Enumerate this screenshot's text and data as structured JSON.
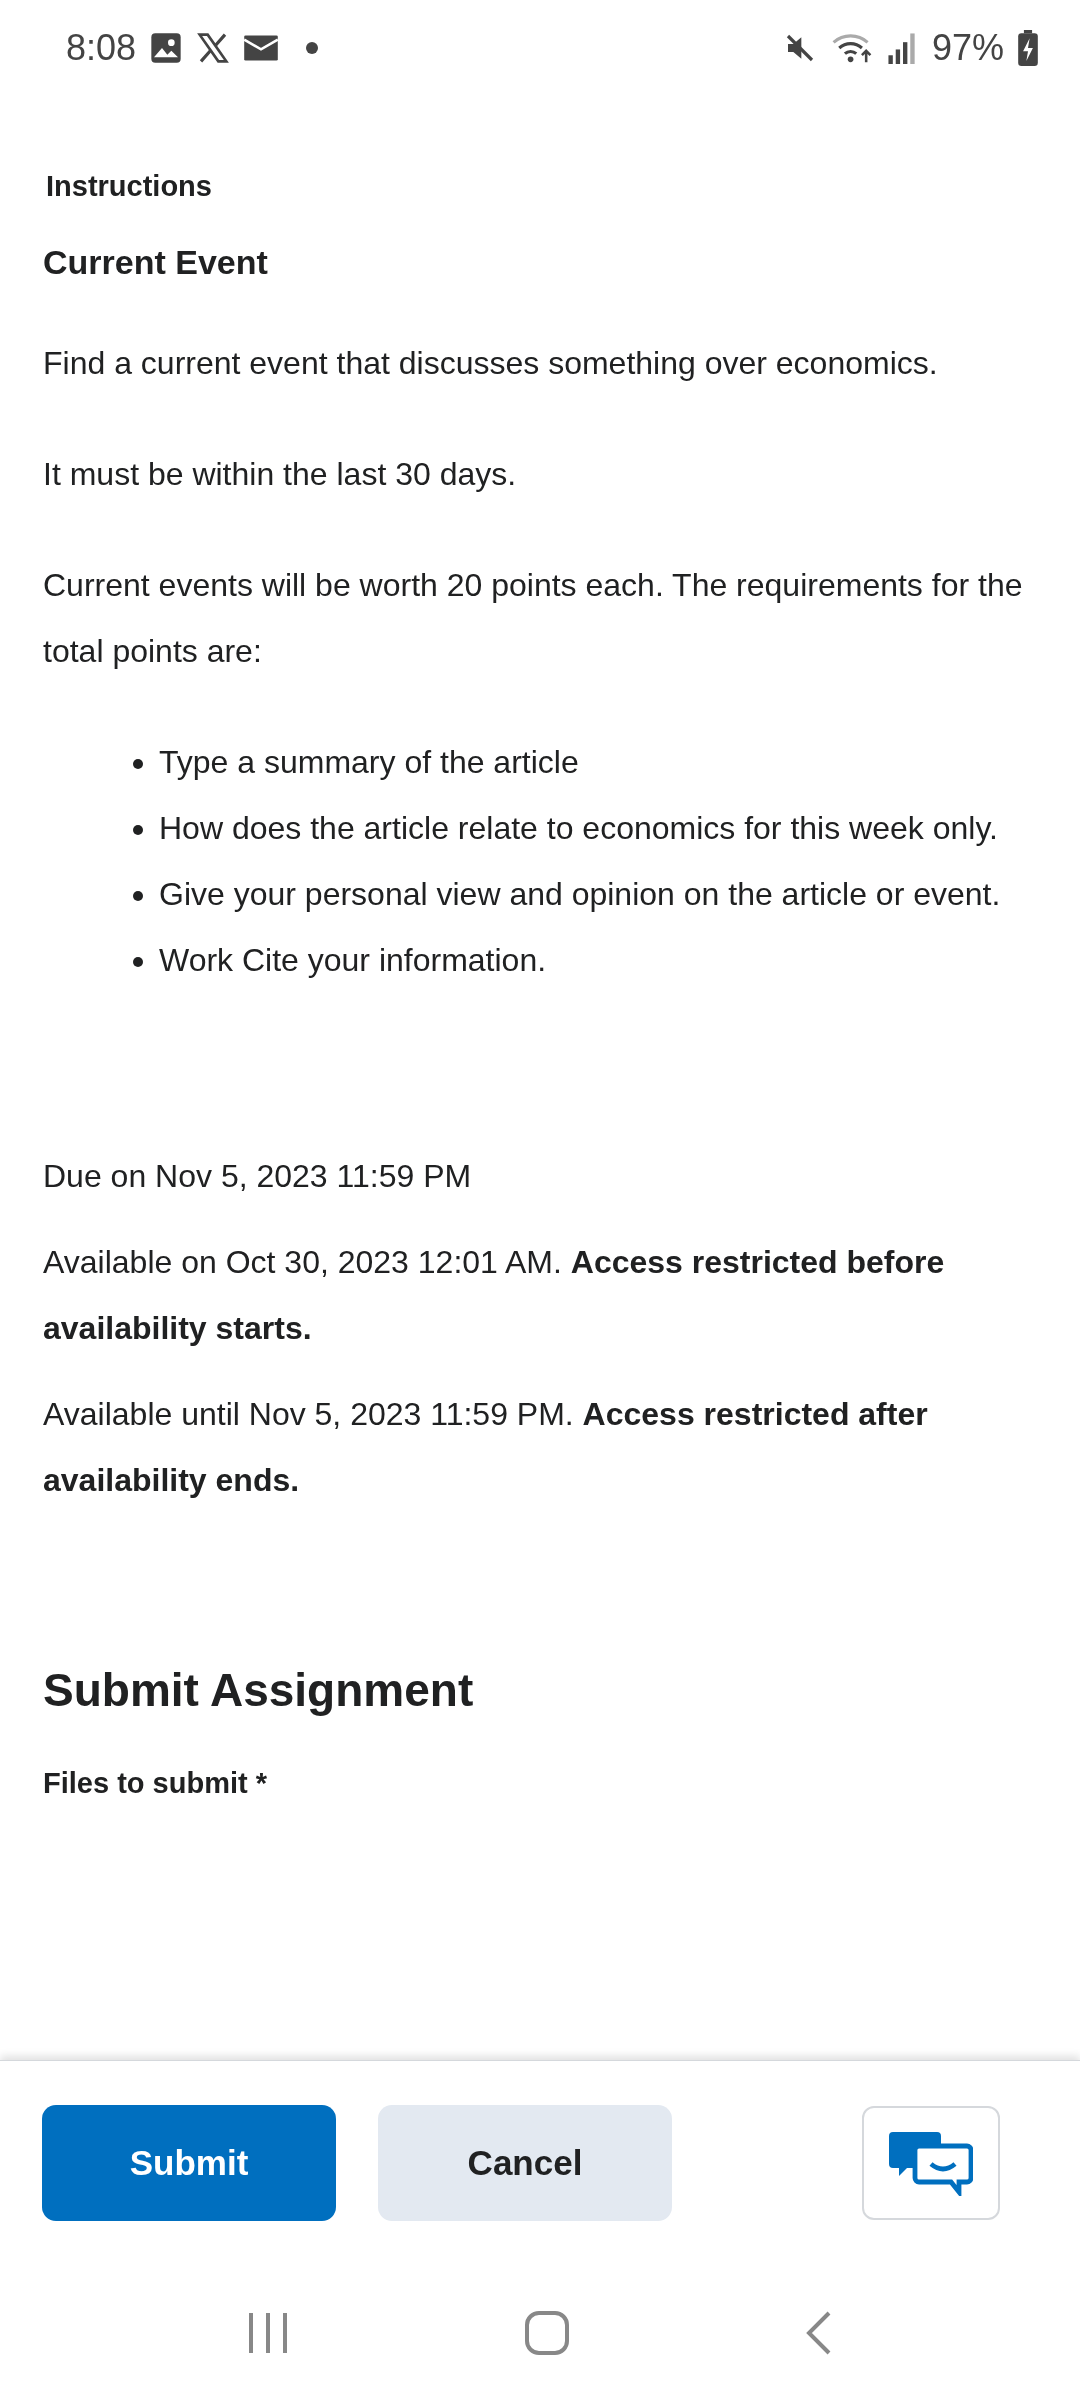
{
  "status_bar": {
    "time": "8:08",
    "battery": "97%"
  },
  "instructions": {
    "label": "Instructions",
    "title": "Current Event",
    "paragraphs": [
      "Find a current event that discusses something over economics.",
      "It must be within the last 30 days.",
      "Current events will be worth 20 points each. The requirements for the total points are:"
    ],
    "bullets": [
      "Type a summary of the article",
      "How does the article relate to economics for this week only.",
      "Give your personal view and opinion on the article or event.",
      "Work Cite your information."
    ]
  },
  "dates": [
    "Due on Nov 5, 2023 11:59 PM",
    "Available on Oct 30, 2023 12:01 AM. **Access restricted before availability starts.**",
    "Available until Nov 5, 2023 11:59 PM. **Access restricted after availability ends.**"
  ],
  "submit_section": {
    "heading": "Submit Assignment",
    "files_label": "Files to submit *"
  },
  "footer": {
    "buttons": [
      {
        "label": "Submit",
        "kind": "primary"
      },
      {
        "label": "Cancel",
        "kind": "secondary"
      }
    ]
  }
}
